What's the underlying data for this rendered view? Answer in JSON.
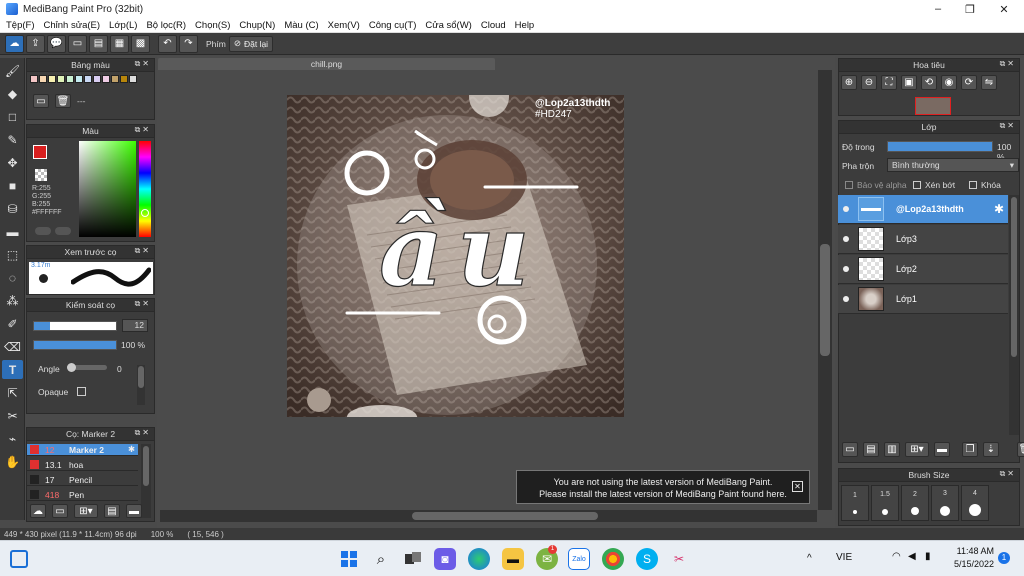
{
  "window": {
    "title": "MediBang Paint Pro (32bit)",
    "controls": [
      "–",
      "❐",
      "✕"
    ]
  },
  "menu": {
    "items": [
      "Tệp(F)",
      "Chỉnh sửa(E)",
      "Lớp(L)",
      "Bộ lọc(R)",
      "Chọn(S)",
      "Chụp(N)",
      "Màu (C)",
      "Xem(V)",
      "Công cụ(T)",
      "Cửa sổ(W)",
      "Cloud",
      "Help"
    ]
  },
  "toolbar": {
    "shortcut_label": "Phím",
    "reset_label": "Đặt lại"
  },
  "palette_panel": {
    "title": "Bảng màu",
    "swatch_label": "---",
    "swatches": [
      "#f4c6c6",
      "#f7d7b2",
      "#f6efb0",
      "#dff2b8",
      "#c9f0d2",
      "#c4ebf0",
      "#c9d8f4",
      "#d9cdf2",
      "#f0cde6",
      "#c2a26a",
      "#b8860b",
      "#dddddd"
    ]
  },
  "color_panel": {
    "title": "Màu",
    "r": "R:255",
    "g": "G:255",
    "b": "B:255",
    "hex": "#FFFFFF",
    "main_color": "#d92020",
    "sub_color": "#ffffff"
  },
  "brush_preview": {
    "title": "Xem trước cọ",
    "size": "3.17m"
  },
  "brush_control": {
    "title": "Kiểm soát cọ",
    "size_value": "12",
    "opacity_value": "100 %",
    "angle_label": "Angle",
    "angle_value": "0",
    "opaque_label": "Opaque"
  },
  "brush_list": {
    "title": "Cọ: Marker 2",
    "items": [
      {
        "size": "12",
        "name": "Marker 2",
        "color": "#e03030"
      },
      {
        "size": "13.1",
        "name": "hoa",
        "color": "#e03030"
      },
      {
        "size": "17",
        "name": "Pencil",
        "color": "#222222"
      },
      {
        "size": "418",
        "name": "Pen",
        "color": "#222222"
      }
    ]
  },
  "document": {
    "tab_name": "chill.png",
    "watermark": "@Lop2a13thdth",
    "hashtag": "#HD247"
  },
  "notice": {
    "line1": "You are not using the latest version of MediBang Paint.",
    "line2": "Please install the latest version of MediBang Paint found here."
  },
  "statusbar": {
    "size": "449 * 430 pixel   (11.9 * 11.4cm)   96 dpi",
    "zoom": "100 %",
    "cursor": "( 15, 546 )"
  },
  "navigator_panel": {
    "title": "Hoa tiêu"
  },
  "layer_panel": {
    "title": "Lớp",
    "opacity_label": "Độ trong",
    "opacity_value": "100 %",
    "blend_label": "Pha trộn",
    "blend_value": "Bình thường",
    "protect_alpha": "Bảo vệ alpha",
    "clipping": "Xén bớt",
    "lock": "Khóa",
    "layers": [
      {
        "name": "@Lop2a13thdth"
      },
      {
        "name": "Lớp3"
      },
      {
        "name": "Lớp2"
      },
      {
        "name": "Lớp1"
      }
    ]
  },
  "brush_size_panel": {
    "title": "Brush Size",
    "sizes": [
      "1",
      "1.5",
      "2",
      "3",
      "4"
    ]
  },
  "taskbar": {
    "lang": "VIE",
    "time": "11:48 AM",
    "date": "5/15/2022",
    "notify_count": "1",
    "zalo_label": "Zalo",
    "chat_badge": "1"
  }
}
